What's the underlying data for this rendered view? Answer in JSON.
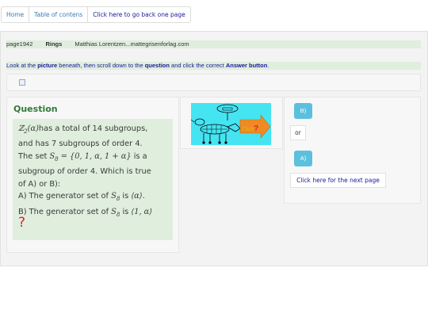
{
  "nav": {
    "home": "Home",
    "toc": "Table of contens",
    "back": "Click here to go back one page"
  },
  "info": {
    "page": "page1942",
    "subject": "Rings",
    "author": "Matthias Lorentzen...mattegrisenforlag.com"
  },
  "instruction": {
    "p1": "Look at the ",
    "b1": "picture",
    "p2": " beneath, then scroll down to the ",
    "b2": "question",
    "p3": " and click the correct ",
    "b3": "Answer button",
    "p4": "."
  },
  "question": {
    "title": "Question",
    "ring": "ℤ",
    "ring_sub": "2",
    "ring_arg": "(α)",
    "line1_rest": "has a total of 14 subgroups,",
    "line2": "and has 7 subgroups of order 4.",
    "line3_pre": "The set ",
    "set_name": "S",
    "set_sub": "8",
    "set_eq": " = {0, 1, α, 1 + α}",
    "line3_post": " is a",
    "line4": "subgroup of order 4. Which is true",
    "line5": "of A) or B):",
    "lineA_pre": "A) The generator set of ",
    "lineA_gen": "⟨α⟩",
    "lineB_pre": "B) The generator set of ",
    "lineB_gen": "⟨1, α⟩",
    "is_word": " is ",
    "period": ".",
    "mark": "?"
  },
  "image": {
    "click_label": "Click",
    "click_q": "?",
    "background": "#45e4f2",
    "arrow_color": "#f08a24"
  },
  "answers": {
    "b_label": "B)",
    "or_label": "or",
    "a_label": "A)",
    "next_label": "Click here for the next page",
    "button_color": "#5bc0de"
  }
}
